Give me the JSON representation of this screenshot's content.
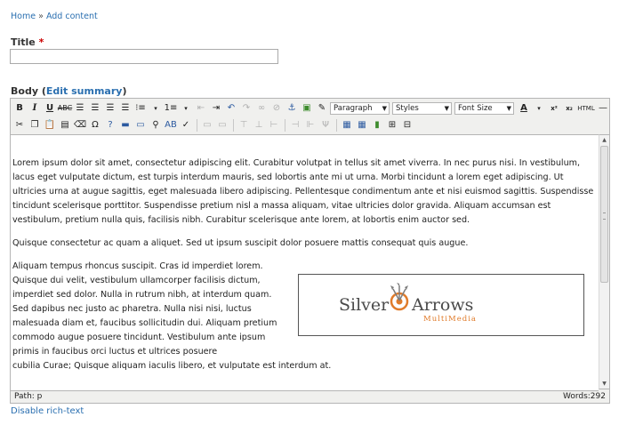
{
  "breadcrumb": {
    "home": "Home",
    "separator": "»",
    "current": "Add content"
  },
  "title_field": {
    "label": "Title",
    "required_mark": "*",
    "value": ""
  },
  "body_field": {
    "label": "Body",
    "open_paren": "(",
    "summary_link": "Edit summary",
    "close_paren": ")"
  },
  "toolbar": {
    "bold": "B",
    "italic": "I",
    "underline": "U",
    "strike": "ABC",
    "format_select": "Paragraph",
    "styles_select": "Styles",
    "fontsize_select": "Font Size",
    "font_color": "A",
    "superscript": "x²",
    "subscript": "x₂",
    "html": "HTML",
    "hr": "—",
    "charmap": "Ω",
    "help": "?"
  },
  "content": {
    "paragraph1": "Lorem ipsum dolor sit amet, consectetur adipiscing elit. Curabitur volutpat in tellus sit amet viverra. In nec purus nisi. In vestibulum, lacus eget vulputate dictum, est turpis interdum mauris, sed lobortis ante mi ut urna. Morbi tincidunt a lorem eget adipiscing. Ut ultricies urna at augue sagittis, eget malesuada libero adipiscing. Pellentesque condimentum ante et nisi euismod sagittis. Suspendisse tincidunt scelerisque porttitor. Suspendisse pretium nisl a massa aliquam, vitae ultricies dolor gravida. Aliquam accumsan est vestibulum, pretium nulla quis, facilisis nibh. Curabitur scelerisque ante lorem, at lobortis enim auctor sed.",
    "paragraph2": "Quisque consectetur ac quam a aliquet. Sed ut ipsum suscipit dolor posuere mattis consequat quis augue.",
    "paragraph3": "Aliquam tempus rhoncus suscipit. Cras id imperdiet lorem. Quisque dui velit, vestibulum ullamcorper facilisis dictum, imperdiet sed dolor. Nulla in rutrum nibh, at interdum quam. Sed dapibus nec justo ac pharetra. Nulla nisi nisi, luctus malesuada diam et, faucibus sollicitudin dui. Aliquam pretium commodo augue posuere tincidunt. Vestibulum ante ipsum primis in faucibus orci luctus et ultrices posuere",
    "paragraph3_last": "cubilia Curae; Quisque aliquam iaculis libero, et vulputate est interdum at.",
    "logo": {
      "word1": "Silver",
      "word2": "Arrows",
      "tagline": "MultiMedia",
      "accent": "#e07b2a",
      "text_color": "#4a4a4a"
    }
  },
  "status": {
    "path": "Path: p",
    "words": "Words:292"
  },
  "disable_rich_text": "Disable rich-text"
}
